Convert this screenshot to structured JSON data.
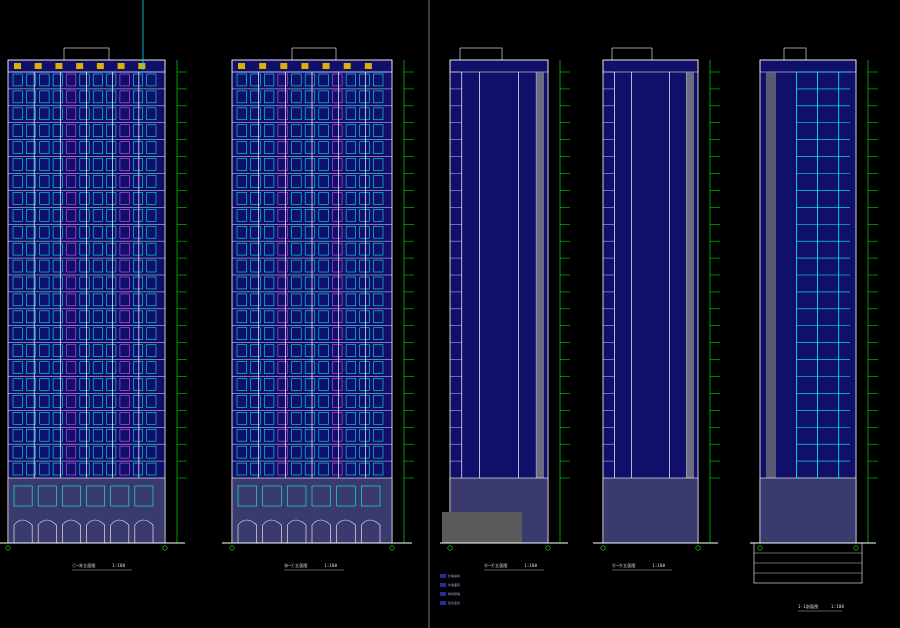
{
  "view": {
    "background": "#000000",
    "colors": {
      "facade": "#10106a",
      "grid_line": "#ffffff",
      "window": "#00ffff",
      "accent": "#ff55ff",
      "level_line": "#00ff00",
      "base": "#3a3a6e",
      "roof_box": "#e0b000",
      "cursor_line": "#00e5ff",
      "caption_text": "#e8e8e8"
    }
  },
  "drawings": [
    {
      "id": "elevation-1",
      "caption": "①~⑳立面图",
      "scale": "1:100",
      "floors": 24,
      "style": "dense"
    },
    {
      "id": "elevation-2",
      "caption": "⑳~①立面图",
      "scale": "1:100",
      "floors": 24,
      "style": "dense"
    },
    {
      "id": "elevation-3",
      "caption": "Ⓐ~Ⓔ立面图",
      "scale": "1:100",
      "floors": 24,
      "style": "side"
    },
    {
      "id": "elevation-4",
      "caption": "Ⓔ~Ⓐ立面图",
      "scale": "1:100",
      "floors": 24,
      "style": "side"
    },
    {
      "id": "section-1",
      "caption": "1-1剖面图",
      "scale": "1:100",
      "floors": 24,
      "style": "section"
    }
  ],
  "legend": [
    "外墙涂料",
    "外墙面砖",
    "玻璃幕墙",
    "铝合金窗"
  ]
}
